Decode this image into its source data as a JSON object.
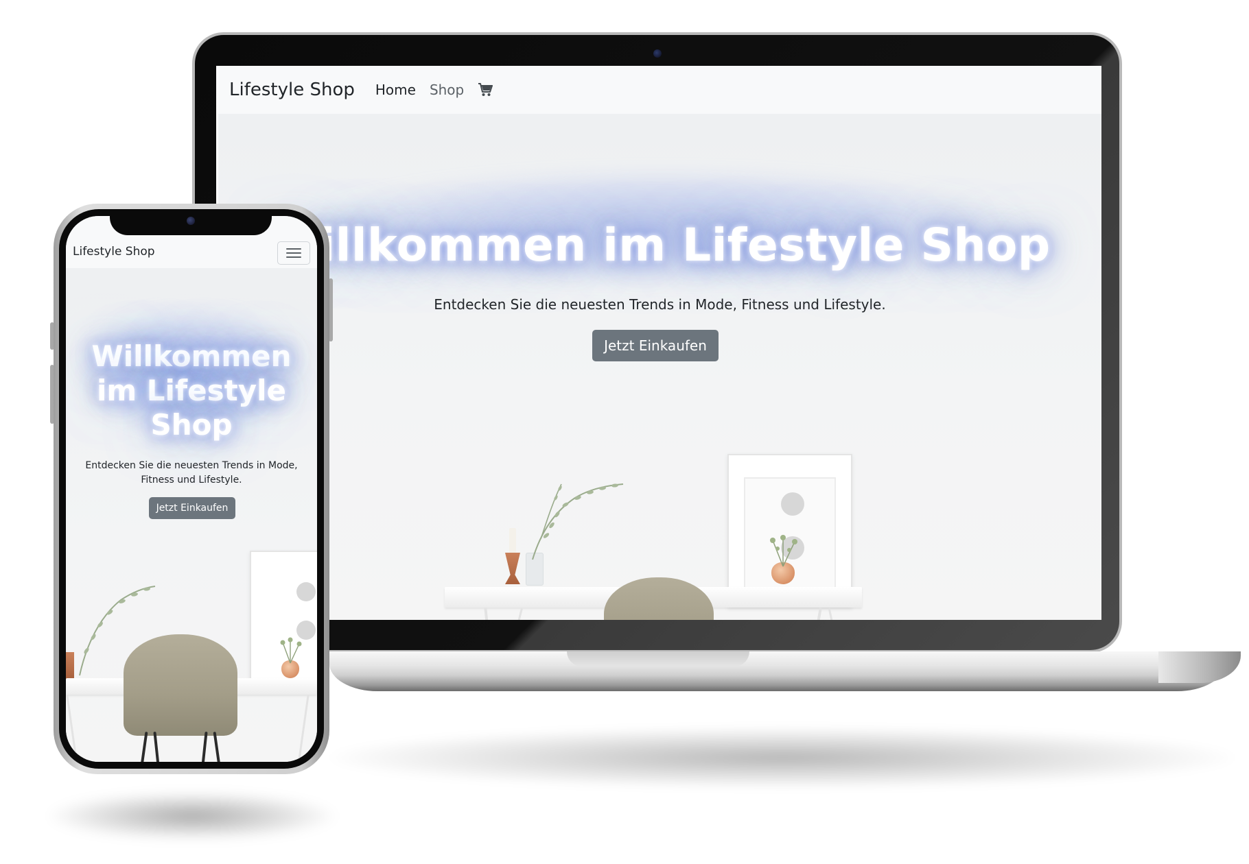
{
  "desktop": {
    "nav": {
      "brand": "Lifestyle Shop",
      "links": [
        "Home",
        "Shop"
      ],
      "cart_icon": "cart-icon"
    },
    "hero": {
      "title": "Willkommen im Lifestyle Shop",
      "subtitle": "Entdecken Sie die neuesten Trends in Mode, Fitness und Lifestyle.",
      "cta": "Jetzt Einkaufen"
    }
  },
  "mobile": {
    "nav": {
      "brand": "Lifestyle Shop",
      "menu_icon": "hamburger-menu-icon"
    },
    "hero": {
      "title_lines": [
        "Willkommen",
        "im Lifestyle",
        "Shop"
      ],
      "subtitle_lines": [
        "Entdecken Sie die neuesten Trends in Mode,",
        "Fitness und Lifestyle."
      ],
      "cta": "Jetzt Einkaufen"
    }
  },
  "colors": {
    "navbar_bg": "#f8f9fa",
    "cta_bg": "#6c757d",
    "title_glow": "#8296e1",
    "text": "#212529"
  }
}
